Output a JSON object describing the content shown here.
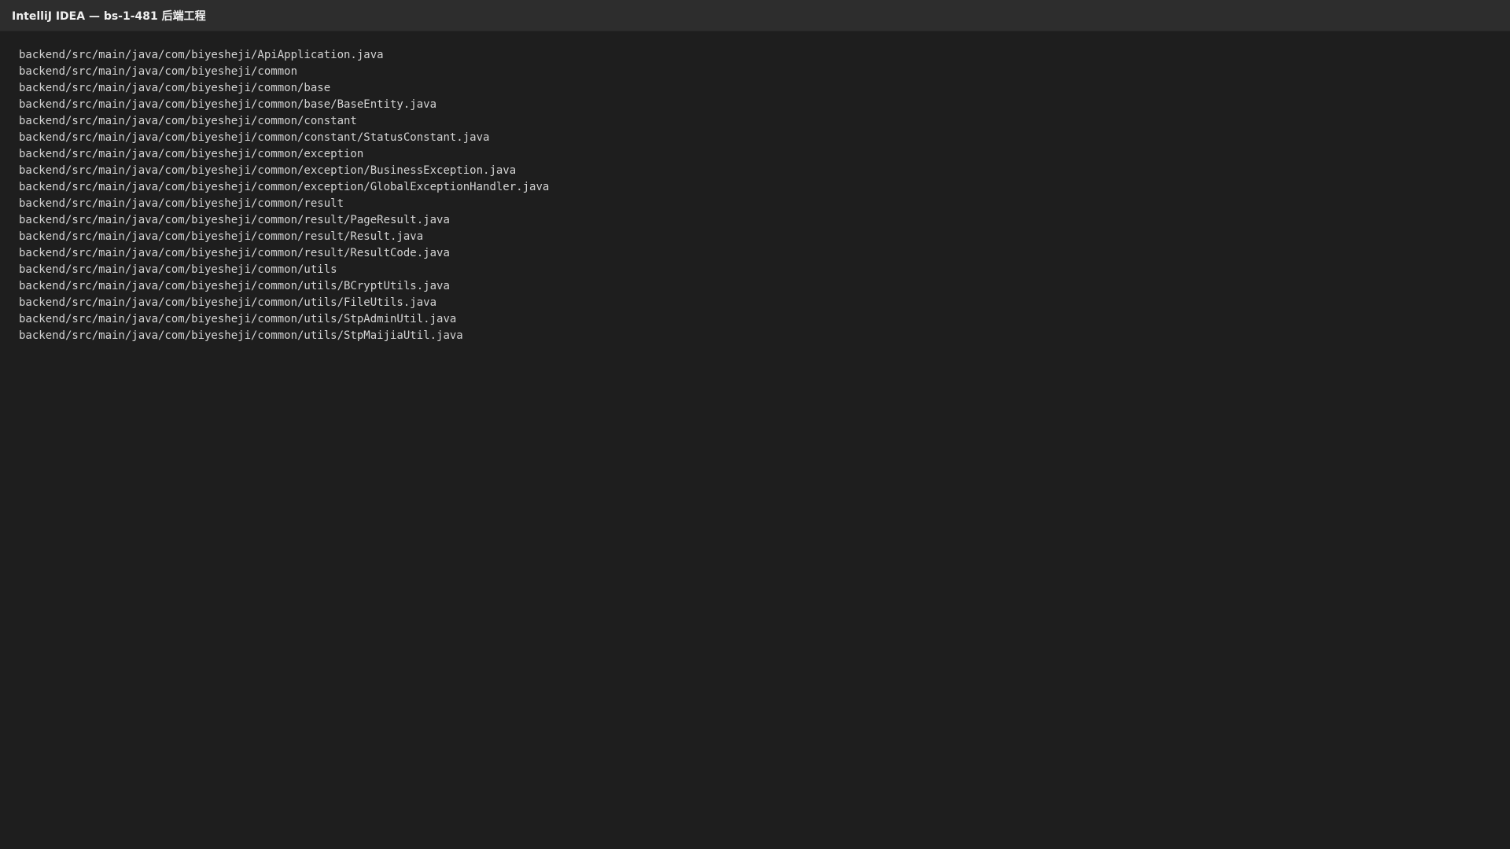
{
  "window": {
    "title": "IntelliJ IDEA — bs-1-481 后端工程"
  },
  "file_list": [
    "backend/src/main/java/com/biyesheji/ApiApplication.java",
    "backend/src/main/java/com/biyesheji/common",
    "backend/src/main/java/com/biyesheji/common/base",
    "backend/src/main/java/com/biyesheji/common/base/BaseEntity.java",
    "backend/src/main/java/com/biyesheji/common/constant",
    "backend/src/main/java/com/biyesheji/common/constant/StatusConstant.java",
    "backend/src/main/java/com/biyesheji/common/exception",
    "backend/src/main/java/com/biyesheji/common/exception/BusinessException.java",
    "backend/src/main/java/com/biyesheji/common/exception/GlobalExceptionHandler.java",
    "backend/src/main/java/com/biyesheji/common/result",
    "backend/src/main/java/com/biyesheji/common/result/PageResult.java",
    "backend/src/main/java/com/biyesheji/common/result/Result.java",
    "backend/src/main/java/com/biyesheji/common/result/ResultCode.java",
    "backend/src/main/java/com/biyesheji/common/utils",
    "backend/src/main/java/com/biyesheji/common/utils/BCryptUtils.java",
    "backend/src/main/java/com/biyesheji/common/utils/FileUtils.java",
    "backend/src/main/java/com/biyesheji/common/utils/StpAdminUtil.java",
    "backend/src/main/java/com/biyesheji/common/utils/StpMaijiaUtil.java"
  ]
}
